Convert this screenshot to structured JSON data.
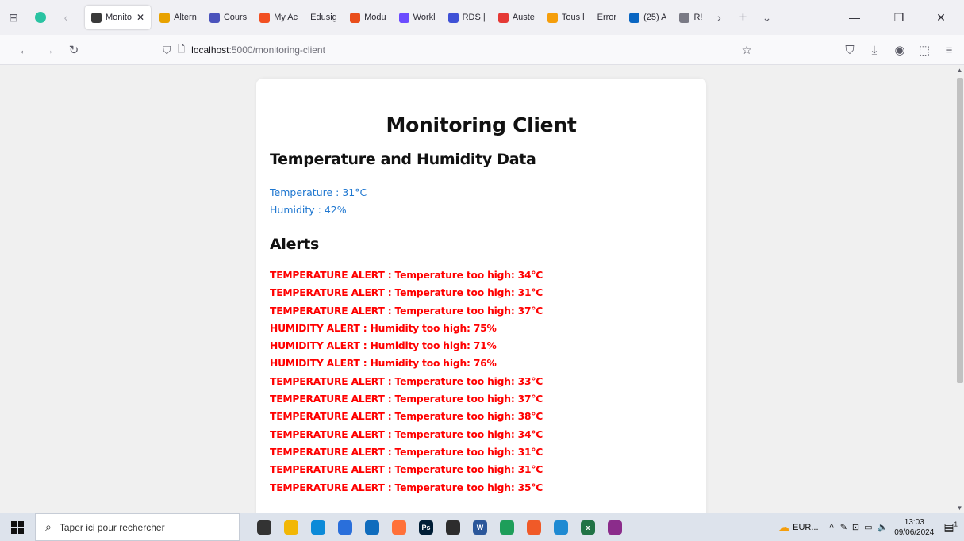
{
  "browser": {
    "tabs": [
      {
        "label": "Monito",
        "active": true,
        "icon": "page-icon",
        "color": "#3a3a3a"
      },
      {
        "label": "Altern",
        "icon": "alternance-icon",
        "color": "#e8a200"
      },
      {
        "label": "Cours",
        "icon": "teams-icon",
        "color": "#4b53bc"
      },
      {
        "label": "My Ac",
        "icon": "microsoft-icon",
        "color": "#f25022"
      },
      {
        "label": "Edusign",
        "icon": "",
        "color": ""
      },
      {
        "label": "Modu",
        "icon": "module-icon",
        "color": "#e94e1b"
      },
      {
        "label": "Workl",
        "icon": "workload-icon",
        "color": "#6c4cff"
      },
      {
        "label": "RDS |",
        "icon": "rds-icon",
        "color": "#3f51d6"
      },
      {
        "label": "Auste",
        "icon": "map-pin-icon",
        "color": "#e53935"
      },
      {
        "label": "Tous l",
        "icon": "box-icon",
        "color": "#f59e0b"
      },
      {
        "label": "Error",
        "icon": "",
        "color": ""
      },
      {
        "label": "(25) A",
        "icon": "linkedin-icon",
        "color": "#0a66c2"
      },
      {
        "label": "R!",
        "icon": "lock-icon",
        "color": "#7a7a85"
      }
    ],
    "url_host": "localhost",
    "url_path": ":5000/monitoring-client"
  },
  "page": {
    "title": "Monitoring Client",
    "data_heading": "Temperature and Humidity Data",
    "temperature": "Temperature : 31°C",
    "humidity": "Humidity : 42%",
    "alerts_heading": "Alerts",
    "alerts": [
      "TEMPERATURE ALERT : Temperature too high: 34°C",
      "TEMPERATURE ALERT : Temperature too high: 31°C",
      "TEMPERATURE ALERT : Temperature too high: 37°C",
      "HUMIDITY ALERT : Humidity too high: 75%",
      "HUMIDITY ALERT : Humidity too high: 71%",
      "HUMIDITY ALERT : Humidity too high: 76%",
      "TEMPERATURE ALERT : Temperature too high: 33°C",
      "TEMPERATURE ALERT : Temperature too high: 37°C",
      "TEMPERATURE ALERT : Temperature too high: 38°C",
      "TEMPERATURE ALERT : Temperature too high: 34°C",
      "TEMPERATURE ALERT : Temperature too high: 31°C",
      "TEMPERATURE ALERT : Temperature too high: 31°C",
      "TEMPERATURE ALERT : Temperature too high: 35°C"
    ]
  },
  "taskbar": {
    "search_placeholder": "Taper ici pour rechercher",
    "apps": [
      {
        "icon": "task-view-icon",
        "color": "#333333",
        "label": ""
      },
      {
        "icon": "file-explorer-icon",
        "color": "#f2b705",
        "label": ""
      },
      {
        "icon": "edge-icon",
        "color": "#0c8ad8",
        "label": ""
      },
      {
        "icon": "store-icon",
        "color": "#2a6fdb",
        "label": ""
      },
      {
        "icon": "mail-icon",
        "color": "#0f6cbd",
        "label": ""
      },
      {
        "icon": "firefox-icon",
        "color": "#ff7139",
        "label": ""
      },
      {
        "icon": "photoshop-icon",
        "color": "#001e36",
        "label": "Ps"
      },
      {
        "icon": "terminal-icon",
        "color": "#2d2d2d",
        "label": ""
      },
      {
        "icon": "word-icon",
        "color": "#2b579a",
        "label": "W"
      },
      {
        "icon": "app-circle-icon",
        "color": "#1e9e5a",
        "label": ""
      },
      {
        "icon": "compass-icon",
        "color": "#f05a28",
        "label": ""
      },
      {
        "icon": "vscode-icon",
        "color": "#1f8ad2",
        "label": ""
      },
      {
        "icon": "excel-icon",
        "color": "#217346",
        "label": "x"
      },
      {
        "icon": "rar-icon",
        "color": "#8b2c8b",
        "label": ""
      }
    ],
    "weather": "EUR...",
    "time": "13:03",
    "date": "09/06/2024",
    "notification_count": "1"
  }
}
